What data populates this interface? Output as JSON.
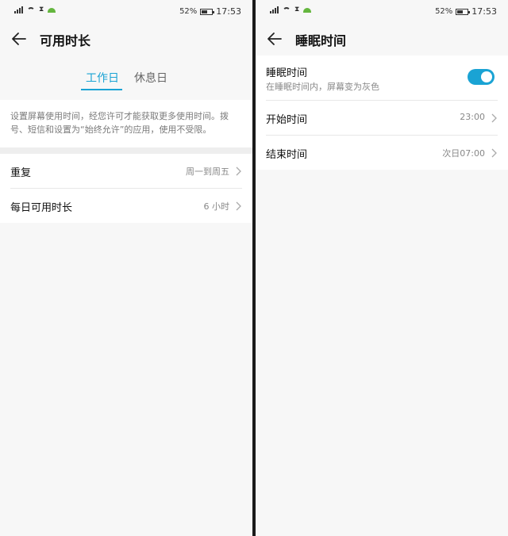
{
  "status_bar": {
    "network": "4G",
    "battery_percent": "52%",
    "battery_level": 0.52,
    "time": "17:53"
  },
  "left": {
    "title": "可用时长",
    "tabs": [
      {
        "label": "工作日",
        "active": true
      },
      {
        "label": "休息日",
        "active": false
      }
    ],
    "description": "设置屏幕使用时间，经您许可才能获取更多使用时间。拨号、短信和设置为“始终允许”的应用，使用不受限。",
    "rows": [
      {
        "label": "重复",
        "value": "周一到周五"
      },
      {
        "label": "每日可用时长",
        "value": "6 小时"
      }
    ]
  },
  "right": {
    "title": "睡眠时间",
    "toggle": {
      "title": "睡眠时间",
      "subtitle": "在睡眠时间内，屏幕变为灰色",
      "on": true
    },
    "rows": [
      {
        "label": "开始时间",
        "value": "23:00"
      },
      {
        "label": "结束时间",
        "value": "次日07:00"
      }
    ]
  },
  "colors": {
    "accent": "#1aa3d4",
    "background": "#f7f7f7"
  },
  "icons": [
    "back-arrow-icon",
    "chevron-right-icon",
    "signal-icon",
    "wifi-icon",
    "hourglass-icon",
    "android-icon",
    "battery-icon"
  ]
}
